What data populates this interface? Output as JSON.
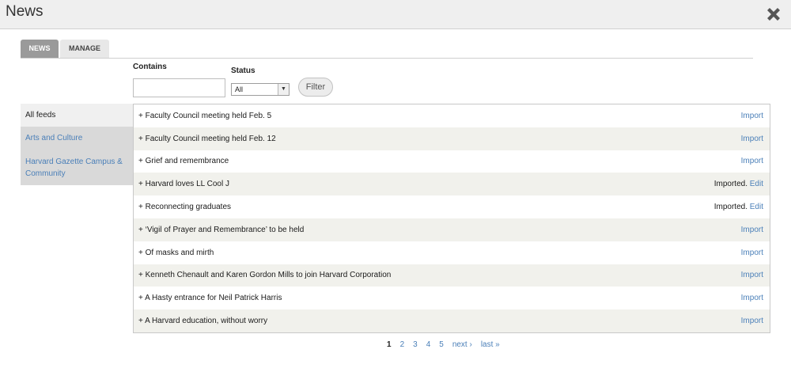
{
  "window": {
    "title": "News",
    "close_icon": "close-icon"
  },
  "tabs": [
    {
      "label": "NEWS",
      "active": true
    },
    {
      "label": "MANAGE",
      "active": false
    }
  ],
  "filters": {
    "contains_label": "Contains",
    "contains_value": "",
    "status_label": "Status",
    "status_value": "All",
    "filter_button": "Filter"
  },
  "sidebar": {
    "items": [
      {
        "label": "All feeds",
        "active": true
      },
      {
        "label": "Arts and Culture",
        "active": false
      },
      {
        "label": "Harvard Gazette Campus & Community",
        "active": false
      }
    ]
  },
  "news": {
    "rows": [
      {
        "title": "+ Faculty Council meeting held Feb. 5",
        "status": "",
        "action": "Import"
      },
      {
        "title": "+ Faculty Council meeting held Feb. 12",
        "status": "",
        "action": "Import"
      },
      {
        "title": "+ Grief and remembrance",
        "status": "",
        "action": "Import"
      },
      {
        "title": "+ Harvard loves LL Cool J",
        "status": "Imported.",
        "action": "Edit"
      },
      {
        "title": "+ Reconnecting graduates",
        "status": "Imported.",
        "action": "Edit"
      },
      {
        "title": "+ ‘Vigil of Prayer and Remembrance’ to be held",
        "status": "",
        "action": "Import"
      },
      {
        "title": "+ Of masks and mirth",
        "status": "",
        "action": "Import"
      },
      {
        "title": "+ Kenneth Chenault and Karen Gordon Mills to join Harvard Corporation",
        "status": "",
        "action": "Import"
      },
      {
        "title": "+ A Hasty entrance for Neil Patrick Harris",
        "status": "",
        "action": "Import"
      },
      {
        "title": "+ A Harvard education, without worry",
        "status": "",
        "action": "Import"
      }
    ]
  },
  "pager": {
    "current": "1",
    "pages": [
      "2",
      "3",
      "4",
      "5"
    ],
    "next": "next ›",
    "last": "last »"
  }
}
